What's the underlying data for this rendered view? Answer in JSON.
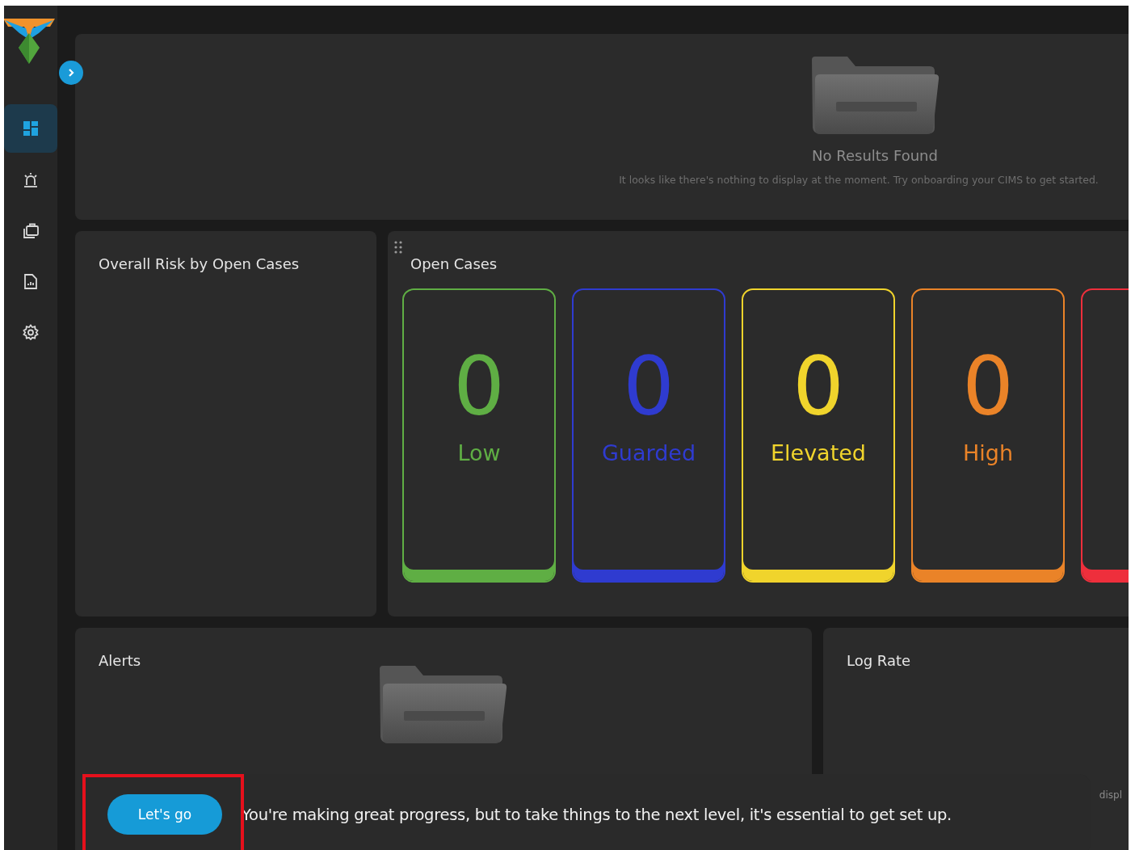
{
  "sidebar": {
    "items": [
      {
        "selected": true
      },
      {
        "selected": false
      },
      {
        "selected": false
      },
      {
        "selected": false
      },
      {
        "selected": false
      }
    ]
  },
  "top_panel": {
    "empty_title": "No Results Found",
    "empty_text": "It looks like there's nothing to display at the moment. Try onboarding your CIMS to get started."
  },
  "risk_panel": {
    "title": "Overall Risk by Open Cases"
  },
  "open_cases": {
    "title": "Open Cases",
    "cards": [
      {
        "count": "0",
        "label": "Low",
        "color": "#5fae44"
      },
      {
        "count": "0",
        "label": "Guarded",
        "color": "#2f3bd0"
      },
      {
        "count": "0",
        "label": "Elevated",
        "color": "#f0d42c"
      },
      {
        "count": "0",
        "label": "High",
        "color": "#ea8328"
      },
      {
        "color": "#ee2f3c"
      }
    ]
  },
  "alerts": {
    "title": "Alerts"
  },
  "log_rate": {
    "title": "Log Rate",
    "text": "displ"
  },
  "banner": {
    "button": "Let's go",
    "message": "You're making great progress, but to take things to the next level, it's essential to get set up."
  }
}
